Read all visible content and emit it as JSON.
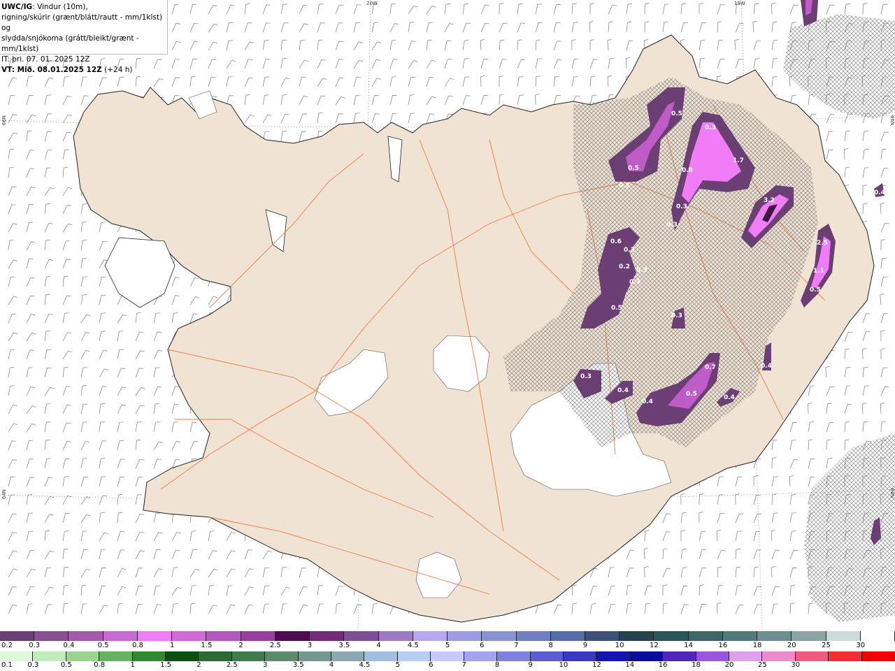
{
  "header": {
    "line1_bold": "UWC/IG",
    "line1_rest": ": Vindur (10m),",
    "line2": "rigning/skúrir (grænt/blátt/rautt - mm/1klst) og",
    "line3": "slydda/snjókoma (grátt/bleikt/grænt - mm/1klst)",
    "line4": "IT: þri. 07. 01. 2025 12Z",
    "line5_bold": "VT: Mið. 08.01.2025 12Z",
    "line5_rest": " (+24 h)"
  },
  "coords": {
    "top_20w": "20W",
    "top_15w": "15W",
    "left_66n": "66N",
    "left_64n": "64N",
    "right_66n": "66N",
    "right_64n": "64N"
  },
  "colors": {
    "land": "#f1e3d4",
    "road": "#f07a40",
    "snow_light": "#c05cc8",
    "snow_mid": "#f07df5",
    "snow_dark": "#6b3f73"
  },
  "precip_labels": [
    "0.5",
    "0.3",
    "1.7",
    "0.5",
    "0.8",
    "0.5",
    "3.2",
    "0.3",
    "0.3",
    "0.6",
    "0.3",
    "0.2",
    "0.3",
    "0.3",
    "2.5",
    "1.1",
    "0.5",
    "0.5",
    "0.3",
    "0.4",
    "0.7",
    "0.3",
    "0.4",
    "0.4",
    "0.5",
    "0.4",
    "0.4"
  ],
  "legend_snow": {
    "colors": [
      "#6b3f73",
      "#8a4e92",
      "#a25aab",
      "#c86ad2",
      "#f07df5",
      "#d06ad8",
      "#b358be",
      "#963f9f",
      "#4f0b4f",
      "#722c7a",
      "#7d4f96",
      "#9d79c2",
      "#b7a7ec",
      "#9f9be2",
      "#8891d1",
      "#6f7fc0",
      "#566ca7",
      "#3d5276",
      "#25434f",
      "#2d5656",
      "#3c6668",
      "#517a7b",
      "#6c8e90",
      "#8aa4a5",
      "#ccdada",
      "#ffffff"
    ],
    "labels": [
      "0.2",
      "0.3",
      "0.4",
      "0.5",
      "0.8",
      "1",
      "1.5",
      "2",
      "2.5",
      "3",
      "3.5",
      "4",
      "4.5",
      "5",
      "6",
      "7",
      "8",
      "9",
      "10",
      "12",
      "14",
      "16",
      "18",
      "20",
      "25",
      "30"
    ]
  },
  "legend_rain": {
    "colors": [
      "#e0f8dc",
      "#c2ecb9",
      "#9ad48e",
      "#65b35f",
      "#2e8b2e",
      "#0a5010",
      "#2b6a32",
      "#3e7a4d",
      "#5c8a6a",
      "#72998f",
      "#8aa8b2",
      "#a1bde0",
      "#b8cdf3",
      "#c8c8fb",
      "#a2a2ee",
      "#8080e0",
      "#5c5cd0",
      "#3838c0",
      "#1414b0",
      "#0a0a9c",
      "#5028b8",
      "#9a55dc",
      "#e0a0f0",
      "#f08ad0",
      "#f05a80",
      "#f03030",
      "#f00000"
    ],
    "labels": [
      "0.1",
      "0.3",
      "0.5",
      "0.8",
      "1",
      "1.5",
      "2",
      "2.5",
      "3",
      "3.5",
      "4",
      "4.5",
      "5",
      "6",
      "7",
      "8",
      "9",
      "10",
      "12",
      "14",
      "16",
      "18",
      "20",
      "25",
      "30"
    ]
  }
}
